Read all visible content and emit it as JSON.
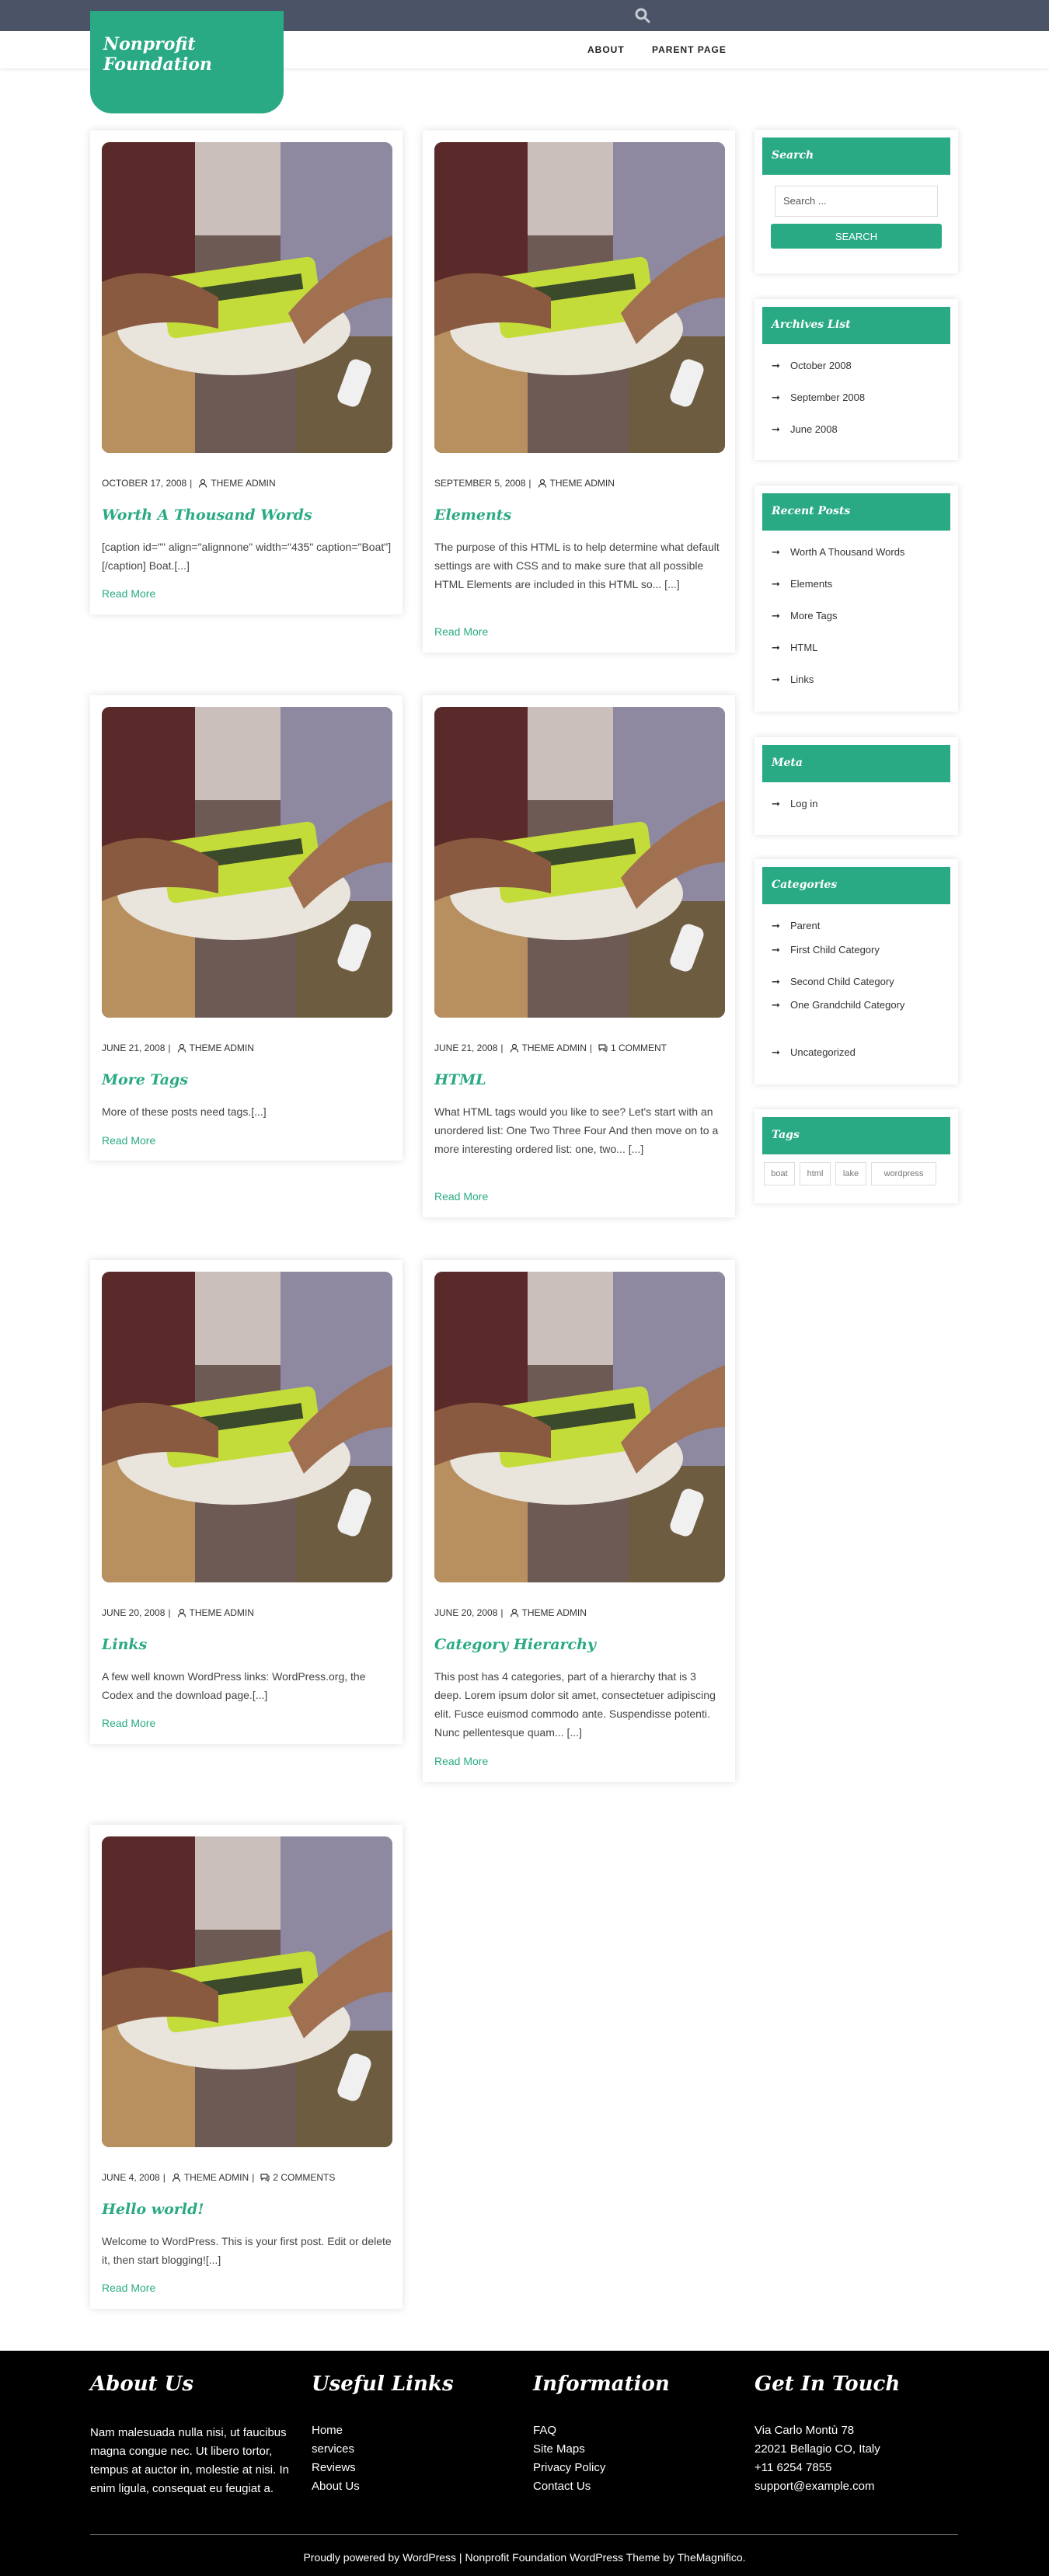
{
  "site": {
    "title": "Nonprofit Foundation",
    "nav": [
      "ABOUT",
      "PARENT PAGE"
    ],
    "accent": "#2aaa84",
    "topbar_color": "#4a5466"
  },
  "posts": [
    {
      "date": "OCTOBER 17, 2008",
      "author": "THEME ADMIN",
      "comments": "",
      "title": "Worth A Thousand Words",
      "excerpt": "[caption id=\"\" align=\"alignnone\" width=\"435\" caption=\"Boat\"][/caption] Boat.[...]",
      "more": "Read More"
    },
    {
      "date": "SEPTEMBER 5, 2008",
      "author": "THEME ADMIN",
      "comments": "",
      "title": "Elements",
      "excerpt": "The purpose of this HTML is to help determine what default settings are with CSS and to make sure that all possible HTML Elements are included in this HTML so... [...]",
      "more": "Read More"
    },
    {
      "date": "JUNE 21, 2008",
      "author": "THEME ADMIN",
      "comments": "",
      "title": "More Tags",
      "excerpt": "More of these posts need tags.[...]",
      "more": "Read More"
    },
    {
      "date": "JUNE 21, 2008",
      "author": "THEME ADMIN",
      "comments": "1 COMMENT",
      "title": "HTML",
      "excerpt": "What HTML tags would you like to see? Let's start with an unordered list: One Two Three Four And then move on to a more interesting ordered list: one, two... [...]",
      "more": "Read More"
    },
    {
      "date": "JUNE 20, 2008",
      "author": "THEME ADMIN",
      "comments": "",
      "title": "Links",
      "excerpt": "A few well known WordPress links: WordPress.org, the Codex and the download page.[...]",
      "more": "Read More"
    },
    {
      "date": "JUNE 20, 2008",
      "author": "THEME ADMIN",
      "comments": "",
      "title": "Category Hierarchy",
      "excerpt": "This post has 4 categories, part of a hierarchy that is 3 deep. Lorem ipsum dolor sit amet, consectetuer adipiscing elit. Fusce euismod commodo ante. Suspendisse potenti. Nunc pellentesque quam... [...]",
      "more": "Read More"
    },
    {
      "date": "JUNE 4, 2008",
      "author": "THEME ADMIN",
      "comments": "2 COMMENTS",
      "title": "Hello world!",
      "excerpt": "Welcome to WordPress. This is your first post. Edit or delete it, then start blogging![...]",
      "more": "Read More"
    }
  ],
  "sidebar": {
    "search": {
      "title": "Search",
      "placeholder": "Search ...",
      "button": "SEARCH"
    },
    "archives": {
      "title": "Archives List",
      "items": [
        "October 2008",
        "September 2008",
        "June 2008"
      ]
    },
    "recent": {
      "title": "Recent Posts",
      "items": [
        "Worth A Thousand Words",
        "Elements",
        "More Tags",
        "HTML",
        "Links"
      ]
    },
    "meta": {
      "title": "Meta",
      "items": [
        "Log in"
      ]
    },
    "categories": {
      "title": "Categories",
      "items": [
        "Parent",
        "First Child Category",
        "Second Child Category",
        "One Grandchild Category",
        "Uncategorized"
      ]
    },
    "tags": {
      "title": "Tags",
      "items": [
        "boat",
        "html",
        "lake",
        "wordpress"
      ]
    }
  },
  "footer": {
    "about": {
      "title": "About Us",
      "text": "Nam malesuada nulla nisi, ut faucibus magna congue nec. Ut libero tortor, tempus at auctor in, molestie at nisi. In enim ligula, consequat eu feugiat a."
    },
    "links": {
      "title": "Useful Links",
      "items": [
        "Home",
        "services",
        "Reviews",
        "About Us"
      ]
    },
    "info": {
      "title": "Information",
      "items": [
        "FAQ",
        "Site Maps",
        "Privacy Policy",
        "Contact Us"
      ]
    },
    "contact": {
      "title": "Get In Touch",
      "items": [
        "Via Carlo Montù 78",
        "22021 Bellagio CO, Italy",
        "+11 6254 7855",
        "support@example.com"
      ]
    },
    "copyright": "Proudly powered by WordPress | Nonprofit Foundation WordPress Theme by TheMagnifico."
  }
}
